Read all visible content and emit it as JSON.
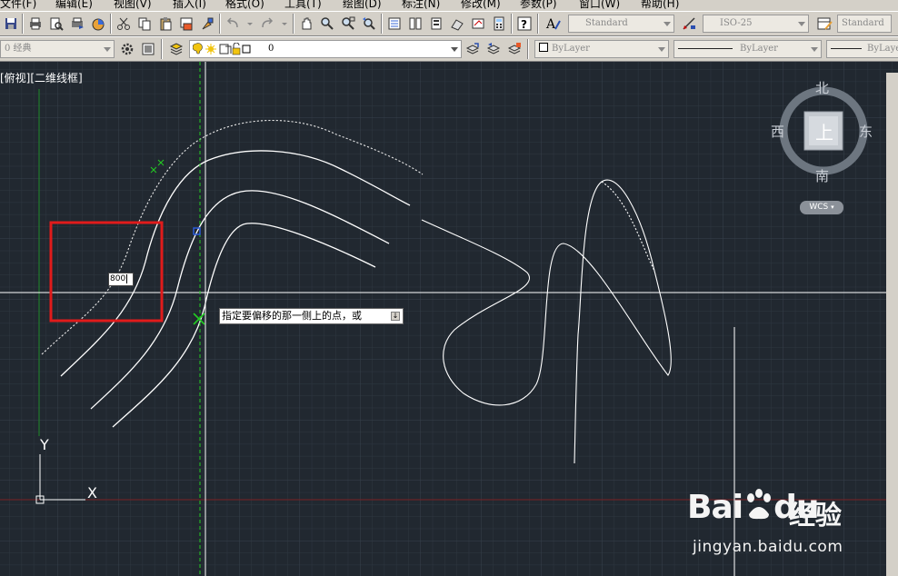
{
  "menu": [
    "文件(F)",
    "编辑(E)",
    "视图(V)",
    "插入(I)",
    "格式(O)",
    "工具(T)",
    "绘图(D)",
    "标注(N)",
    "修改(M)",
    "参数(P)",
    "窗口(W)",
    "帮助(H)"
  ],
  "toolbar": {
    "text_style": "Standard",
    "dim_style": "ISO-25",
    "table_style": "Standard",
    "workspace": "0 经典",
    "layer": "0",
    "color": "ByLayer",
    "linetype": "ByLayer",
    "lineweight": "ByLaye"
  },
  "viewport": {
    "label": "[俯视][二维线框]"
  },
  "dynamic_input": {
    "value": "800"
  },
  "tooltip": {
    "text": "指定要偏移的那一侧上的点，或",
    "icon": "↓"
  },
  "viewcube": {
    "north": "北",
    "south": "南",
    "east": "东",
    "west": "西",
    "face": "上",
    "wcs": "WCS"
  },
  "ucs": {
    "y": "Y",
    "x": "X"
  },
  "watermark": {
    "brand": "Bai",
    "brand2": "du",
    "cn": "经验",
    "url": "jingyan.baidu.com"
  },
  "colors": {
    "canvas_bg": "#212830",
    "grid": "#2e3741",
    "highlight_box": "#e11b1b",
    "crosshair": "#ffffff",
    "snap_marker": "#22cc22"
  }
}
